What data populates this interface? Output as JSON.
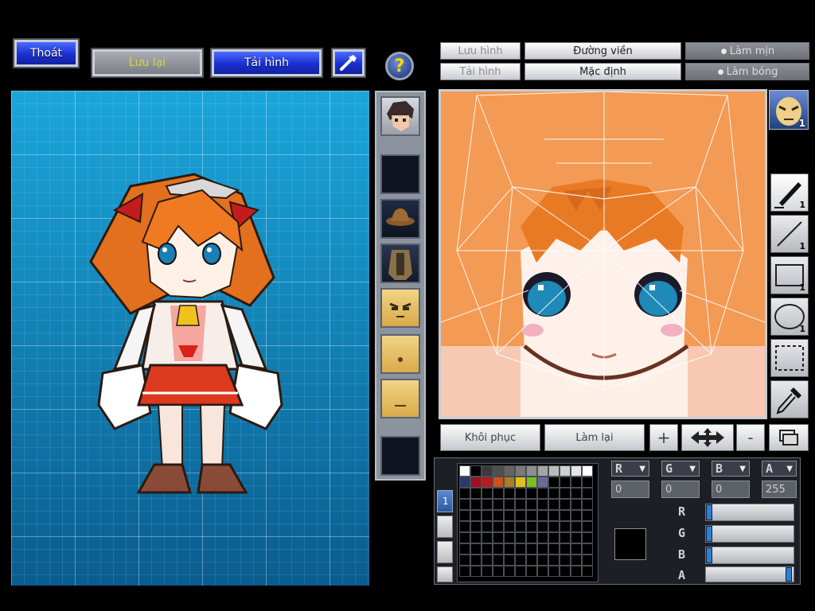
{
  "toolbar": {
    "exit_label": "Thoát",
    "save_label": "Lưu lại",
    "load_label": "Tải hình",
    "help_label": "?"
  },
  "editor_header": {
    "save_image": "Lưu hình",
    "load_image": "Tải hình",
    "outline": "Đường viền",
    "default": "Mặc định",
    "smooth": "Làm mịn",
    "shade": "Làm bóng"
  },
  "face_badge": "1",
  "tools": [
    {
      "name": "pen",
      "num": "1"
    },
    {
      "name": "line",
      "num": "1"
    },
    {
      "name": "rectangle",
      "num": "1"
    },
    {
      "name": "ellipse",
      "num": "1"
    },
    {
      "name": "selection",
      "num": ""
    },
    {
      "name": "eyedropper",
      "num": ""
    }
  ],
  "bottom": {
    "restore": "Khôi phục",
    "redo": "Làm lại",
    "zoom_in": "+",
    "zoom_out": "-"
  },
  "palette": {
    "tab_label": "1",
    "colors": [
      "#ffffff",
      "#000000",
      "#3a3a3a",
      "#4f4f4f",
      "#646464",
      "#7a7a7a",
      "#8f8f8f",
      "#a5a5a5",
      "#bbbbbb",
      "#d0d0d0",
      "#e6e6e6",
      "#ffffff",
      "#2a3a6a",
      "#a01020",
      "#c01818",
      "#d0501a",
      "#a88020",
      "#e0c020",
      "#7ac020",
      "#6a6a9a"
    ]
  },
  "channels": {
    "r_label": "R",
    "g_label": "G",
    "b_label": "B",
    "a_label": "A",
    "r_value": "0",
    "g_value": "0",
    "b_value": "0",
    "a_value": "255",
    "r_level": 0,
    "g_level": 0,
    "b_level": 0,
    "a_level": 1
  }
}
